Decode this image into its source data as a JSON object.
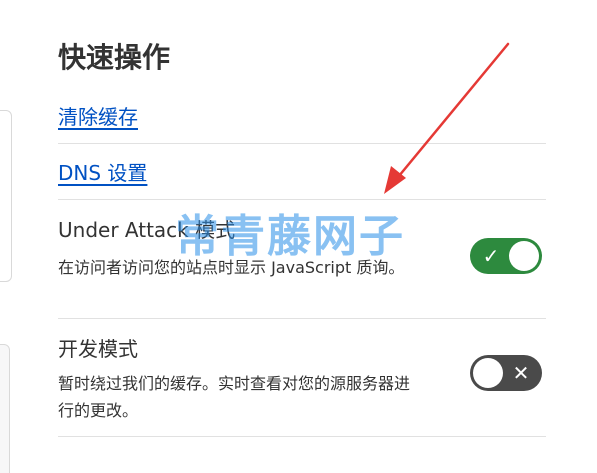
{
  "quick_actions": {
    "title": "快速操作",
    "clear_cache_link": "清除缓存",
    "dns_settings_link": "DNS 设置"
  },
  "under_attack": {
    "title": "Under Attack 模式",
    "description": "在访问者访问您的站点时显示 JavaScript 质询。",
    "enabled": true,
    "state_icon": "check-icon"
  },
  "dev_mode": {
    "title": "开发模式",
    "description": "暂时绕过我们的缓存。实时查看对您的源服务器进行的更改。",
    "enabled": false,
    "state_icon": "close-icon"
  },
  "watermark": "常青藤网子",
  "colors": {
    "link": "#0051c3",
    "toggle_on": "#2d8a3e",
    "toggle_off": "#4a4a4a",
    "annotation_arrow": "#e53935",
    "watermark": "#2a8fe8"
  }
}
